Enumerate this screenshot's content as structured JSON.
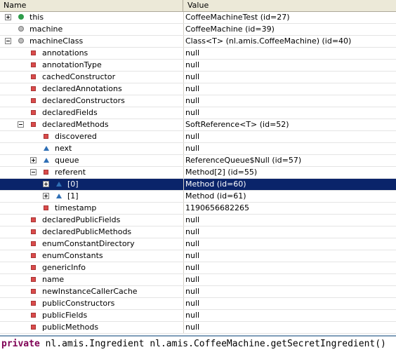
{
  "columns": {
    "name": "Name",
    "value": "Value"
  },
  "rows": [
    {
      "name": "this",
      "value": "CoffeeMachineTest  (id=27)",
      "indent": 0,
      "expander": "plus",
      "icon": "green"
    },
    {
      "name": "machine",
      "value": "CoffeeMachine  (id=39)",
      "indent": 0,
      "expander": "",
      "icon": "gray"
    },
    {
      "name": "machineClass",
      "value": "Class<T> (nl.amis.CoffeeMachine) (id=40)",
      "indent": 0,
      "expander": "minus",
      "icon": "gray"
    },
    {
      "name": "annotations",
      "value": "null",
      "indent": 1,
      "expander": "",
      "icon": "red"
    },
    {
      "name": "annotationType",
      "value": "null",
      "indent": 1,
      "expander": "",
      "icon": "red"
    },
    {
      "name": "cachedConstructor",
      "value": "null",
      "indent": 1,
      "expander": "",
      "icon": "red"
    },
    {
      "name": "declaredAnnotations",
      "value": "null",
      "indent": 1,
      "expander": "",
      "icon": "red"
    },
    {
      "name": "declaredConstructors",
      "value": "null",
      "indent": 1,
      "expander": "",
      "icon": "red"
    },
    {
      "name": "declaredFields",
      "value": "null",
      "indent": 1,
      "expander": "",
      "icon": "red"
    },
    {
      "name": "declaredMethods",
      "value": "SoftReference<T>  (id=52)",
      "indent": 1,
      "expander": "minus",
      "icon": "red"
    },
    {
      "name": "discovered",
      "value": "null",
      "indent": 2,
      "expander": "",
      "icon": "red"
    },
    {
      "name": "next",
      "value": "null",
      "indent": 2,
      "expander": "",
      "icon": "blue"
    },
    {
      "name": "queue",
      "value": "ReferenceQueue$Null  (id=57)",
      "indent": 2,
      "expander": "plus",
      "icon": "blue"
    },
    {
      "name": "referent",
      "value": "Method[2]  (id=55)",
      "indent": 2,
      "expander": "minus",
      "icon": "red"
    },
    {
      "name": "[0]",
      "value": "Method  (id=60)",
      "indent": 3,
      "expander": "plus",
      "icon": "blue",
      "selected": true
    },
    {
      "name": "[1]",
      "value": "Method  (id=61)",
      "indent": 3,
      "expander": "plus",
      "icon": "blue"
    },
    {
      "name": "timestamp",
      "value": "1190656682265",
      "indent": 2,
      "expander": "",
      "icon": "red"
    },
    {
      "name": "declaredPublicFields",
      "value": "null",
      "indent": 1,
      "expander": "",
      "icon": "red"
    },
    {
      "name": "declaredPublicMethods",
      "value": "null",
      "indent": 1,
      "expander": "",
      "icon": "red"
    },
    {
      "name": "enumConstantDirectory",
      "value": "null",
      "indent": 1,
      "expander": "",
      "icon": "red"
    },
    {
      "name": "enumConstants",
      "value": "null",
      "indent": 1,
      "expander": "",
      "icon": "red"
    },
    {
      "name": "genericInfo",
      "value": "null",
      "indent": 1,
      "expander": "",
      "icon": "red"
    },
    {
      "name": "name",
      "value": "null",
      "indent": 1,
      "expander": "",
      "icon": "red"
    },
    {
      "name": "newInstanceCallerCache",
      "value": "null",
      "indent": 1,
      "expander": "",
      "icon": "red"
    },
    {
      "name": "publicConstructors",
      "value": "null",
      "indent": 1,
      "expander": "",
      "icon": "red"
    },
    {
      "name": "publicFields",
      "value": "null",
      "indent": 1,
      "expander": "",
      "icon": "red"
    },
    {
      "name": "publicMethods",
      "value": "null",
      "indent": 1,
      "expander": "",
      "icon": "red"
    }
  ],
  "detail": {
    "keyword": "private",
    "rest": " nl.amis.Ingredient nl.amis.CoffeeMachine.getSecretIngredient()"
  },
  "colors": {
    "selection": "#0a246a",
    "field": "#d94b4b",
    "inherited": "#2f6fb5",
    "local": "#2e9c4a"
  }
}
